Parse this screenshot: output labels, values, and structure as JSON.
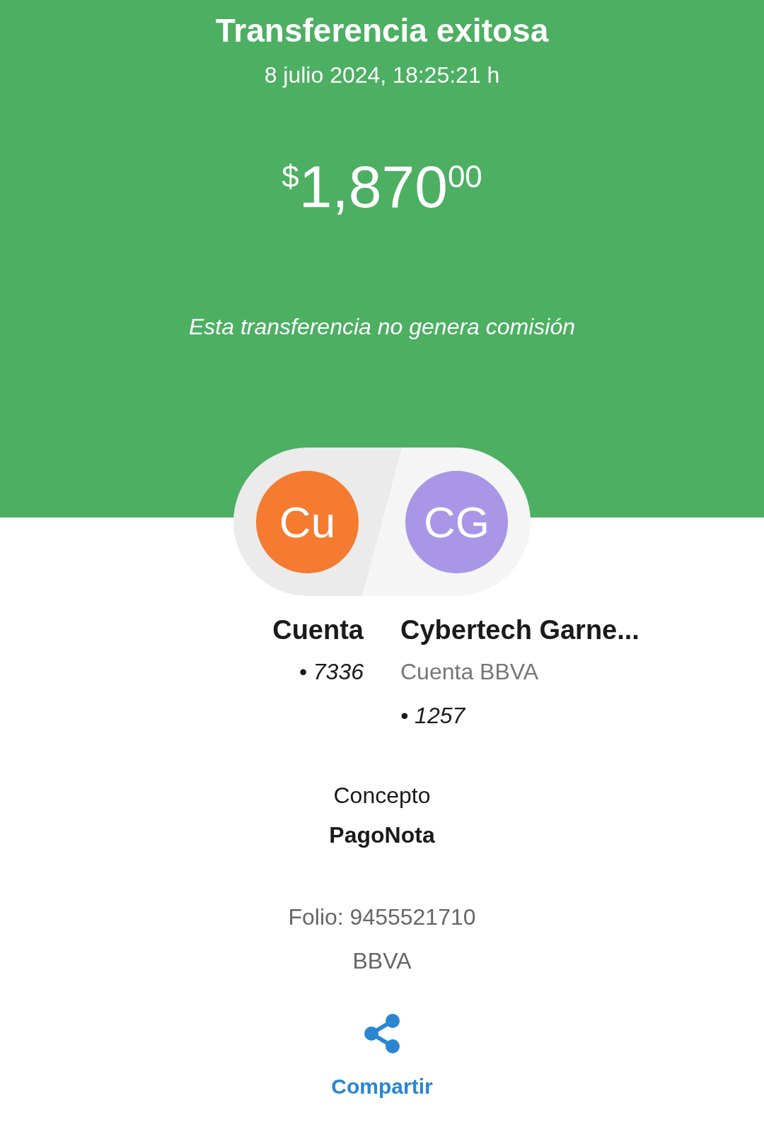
{
  "header": {
    "title": "Transferencia exitosa",
    "datetime": "8 julio 2024, 18:25:21 h",
    "amount": {
      "currency": "$",
      "integer": "1,870",
      "cents": "00"
    },
    "note": "Esta transferencia no genera comisión"
  },
  "parties": [
    {
      "initials": "Cu",
      "color": "#f47b30",
      "name": "Cuenta",
      "account": "• 7336"
    },
    {
      "initials": "CG",
      "color": "#a996e6",
      "name": "Cybertech Garne...",
      "bank": "Cuenta BBVA",
      "account": "• 1257"
    }
  ],
  "concept": {
    "label": "Concepto",
    "value": "PagoNota"
  },
  "folio": "Folio: 9455521710",
  "bank": "BBVA",
  "share": {
    "label": "Compartir"
  }
}
